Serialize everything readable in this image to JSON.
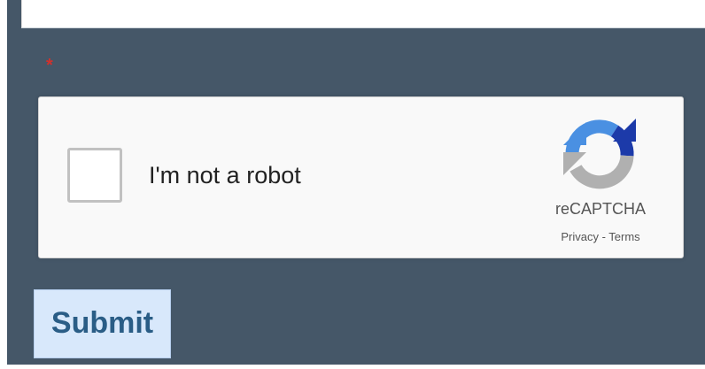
{
  "form": {
    "required_marker": "*",
    "submit_label": "Submit"
  },
  "recaptcha": {
    "checkbox_label": "I'm not a robot",
    "brand": "reCAPTCHA",
    "privacy_label": "Privacy",
    "separator": " - ",
    "terms_label": "Terms",
    "logo_icon": "recaptcha-logo-icon",
    "checked": false
  },
  "colors": {
    "panel_background": "#455768",
    "required_marker": "#d0312d",
    "recaptcha_blue": "#4a90e2",
    "recaptcha_dark_blue": "#1c3aa9",
    "recaptcha_gray": "#b0b0b0",
    "submit_background": "#d8e8fb",
    "submit_text": "#2a5d86"
  }
}
